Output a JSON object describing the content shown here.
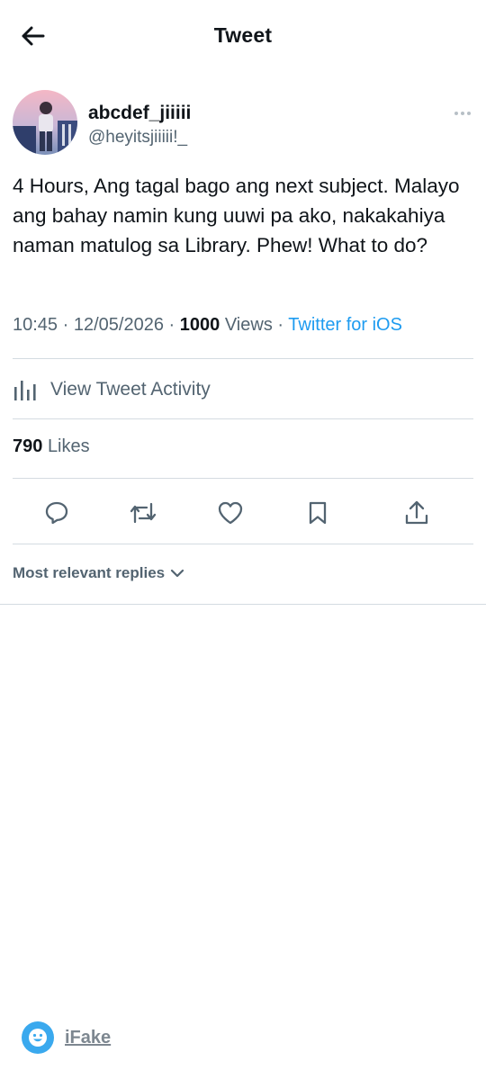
{
  "header": {
    "title": "Tweet"
  },
  "author": {
    "display_name": "abcdef_jiiiii",
    "handle": "@heyitsjiiiii!_"
  },
  "tweet": {
    "text": "4 Hours, Ang tagal bago ang next subject. Malayo ang bahay namin kung uuwi pa ako, nakakahiya naman matulog sa Library. Phew! What to do?",
    "time": "10:45",
    "sep1": "·",
    "date": "12/05/2026",
    "sep2": "·",
    "views_count": "1000",
    "views_label": "Views",
    "sep3": "·",
    "source": "Twitter for iOS"
  },
  "activity": {
    "label": "View Tweet Activity"
  },
  "likes": {
    "count": "790",
    "label": "Likes"
  },
  "actions": [
    "reply-icon",
    "retweet-icon",
    "like-icon",
    "bookmark-icon",
    "share-icon"
  ],
  "replies": {
    "sort_label": "Most relevant replies"
  },
  "watermark": {
    "label": "iFake"
  },
  "colors": {
    "accent": "#1d9bf0",
    "text": "#0f1419",
    "secondary": "#536471",
    "divider": "#d4dbe1"
  }
}
